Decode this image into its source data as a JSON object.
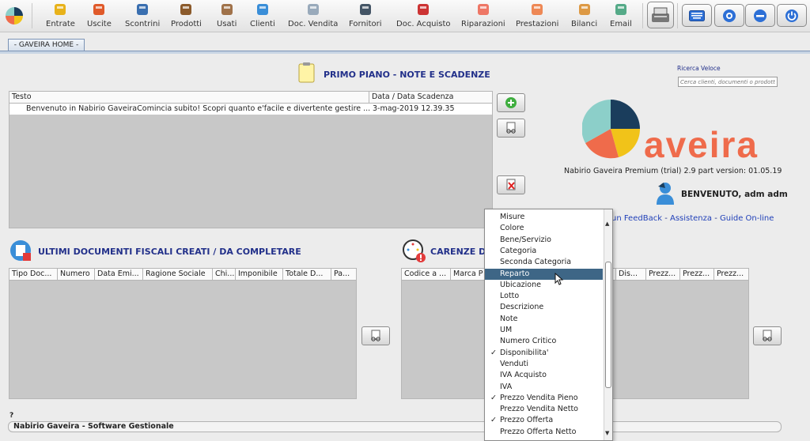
{
  "toolbar": {
    "items": [
      {
        "label": "Entrate",
        "icon": "coin-up-icon"
      },
      {
        "label": "Uscite",
        "icon": "coin-down-icon"
      },
      {
        "label": "Scontrini",
        "icon": "receipt-icon"
      },
      {
        "label": "Prodotti",
        "icon": "box-icon"
      },
      {
        "label": "Usati",
        "icon": "used-box-icon"
      },
      {
        "label": "Clienti",
        "icon": "user-icon"
      },
      {
        "label": "Doc. Vendita",
        "icon": "doc-sale-icon"
      },
      {
        "label": "Fornitori",
        "icon": "supplier-icon"
      },
      {
        "label": "Doc. Acquisto",
        "icon": "doc-purchase-icon"
      },
      {
        "label": "Riparazioni",
        "icon": "printer-icon"
      },
      {
        "label": "Prestazioni",
        "icon": "service-icon"
      },
      {
        "label": "Bilanci",
        "icon": "balance-icon"
      },
      {
        "label": "Email",
        "icon": "email-icon"
      }
    ]
  },
  "tabs": {
    "home": "- GAVEIRA HOME -"
  },
  "notes": {
    "title": "PRIMO PIANO  -  NOTE E SCADENZE",
    "columns": [
      "Testo",
      "Data / Data Scadenza"
    ],
    "rows": [
      {
        "text": "Benvenuto in Nabirio GaveiraComincia subito! Scopri quanto e'facile e divertente gestire ...",
        "date": "3-mag-2019 12.39.35"
      }
    ]
  },
  "search": {
    "label": "Ricerca Veloce",
    "placeholder": "Cerca clienti, documenti o prodotti"
  },
  "brand": {
    "logo_text": "aveira",
    "version": "Nabirio Gaveira Premium (trial) 2.9 part version: 01.05.19",
    "welcome": "BENVENUTO, adm adm",
    "links": [
      "un FeedBack",
      "Assistenza",
      "Guide On-line"
    ],
    "colors": {
      "navy": "#1a3d5c",
      "teal": "#8ccfc9",
      "yellow": "#f1c319",
      "orange": "#ef6b4b"
    }
  },
  "docs": {
    "title": "ULTIMI DOCUMENTI FISCALI CREATI / DA COMPLETARE",
    "columns": [
      "Tipo Doc...",
      "Numero",
      "Data Emi...",
      "Ragione Sociale",
      "Chi...",
      "Imponibile",
      "Totale D...",
      "Pa..."
    ]
  },
  "shortages": {
    "title": "CARENZE DI",
    "columns": [
      "Codice a ...",
      "Marca P",
      "Dis...",
      "Prezz...",
      "Prezz...",
      "Prezz..."
    ]
  },
  "column_menu": {
    "items": [
      {
        "label": "Misure",
        "checked": false
      },
      {
        "label": "Colore",
        "checked": false
      },
      {
        "label": "Bene/Servizio",
        "checked": false
      },
      {
        "label": "Categoria",
        "checked": false
      },
      {
        "label": "Seconda Categoria",
        "checked": false
      },
      {
        "label": "Reparto",
        "checked": false,
        "selected": true
      },
      {
        "label": "Ubicazione",
        "checked": false
      },
      {
        "label": "Lotto",
        "checked": false
      },
      {
        "label": "Descrizione",
        "checked": false
      },
      {
        "label": "Note",
        "checked": false
      },
      {
        "label": "UM",
        "checked": false
      },
      {
        "label": "Numero Critico",
        "checked": false
      },
      {
        "label": "Disponibilita'",
        "checked": true
      },
      {
        "label": "Venduti",
        "checked": false
      },
      {
        "label": "IVA Acquisto",
        "checked": false
      },
      {
        "label": "IVA",
        "checked": false
      },
      {
        "label": "Prezzo Vendita Pieno",
        "checked": true
      },
      {
        "label": "Prezzo Vendita Netto",
        "checked": false
      },
      {
        "label": "Prezzo Offerta",
        "checked": true
      },
      {
        "label": "Prezzo Offerta Netto",
        "checked": false
      }
    ],
    "check_glyph": "✓"
  },
  "footer": {
    "help": "?",
    "status": "Nabirio Gaveira - Software Gestionale"
  }
}
